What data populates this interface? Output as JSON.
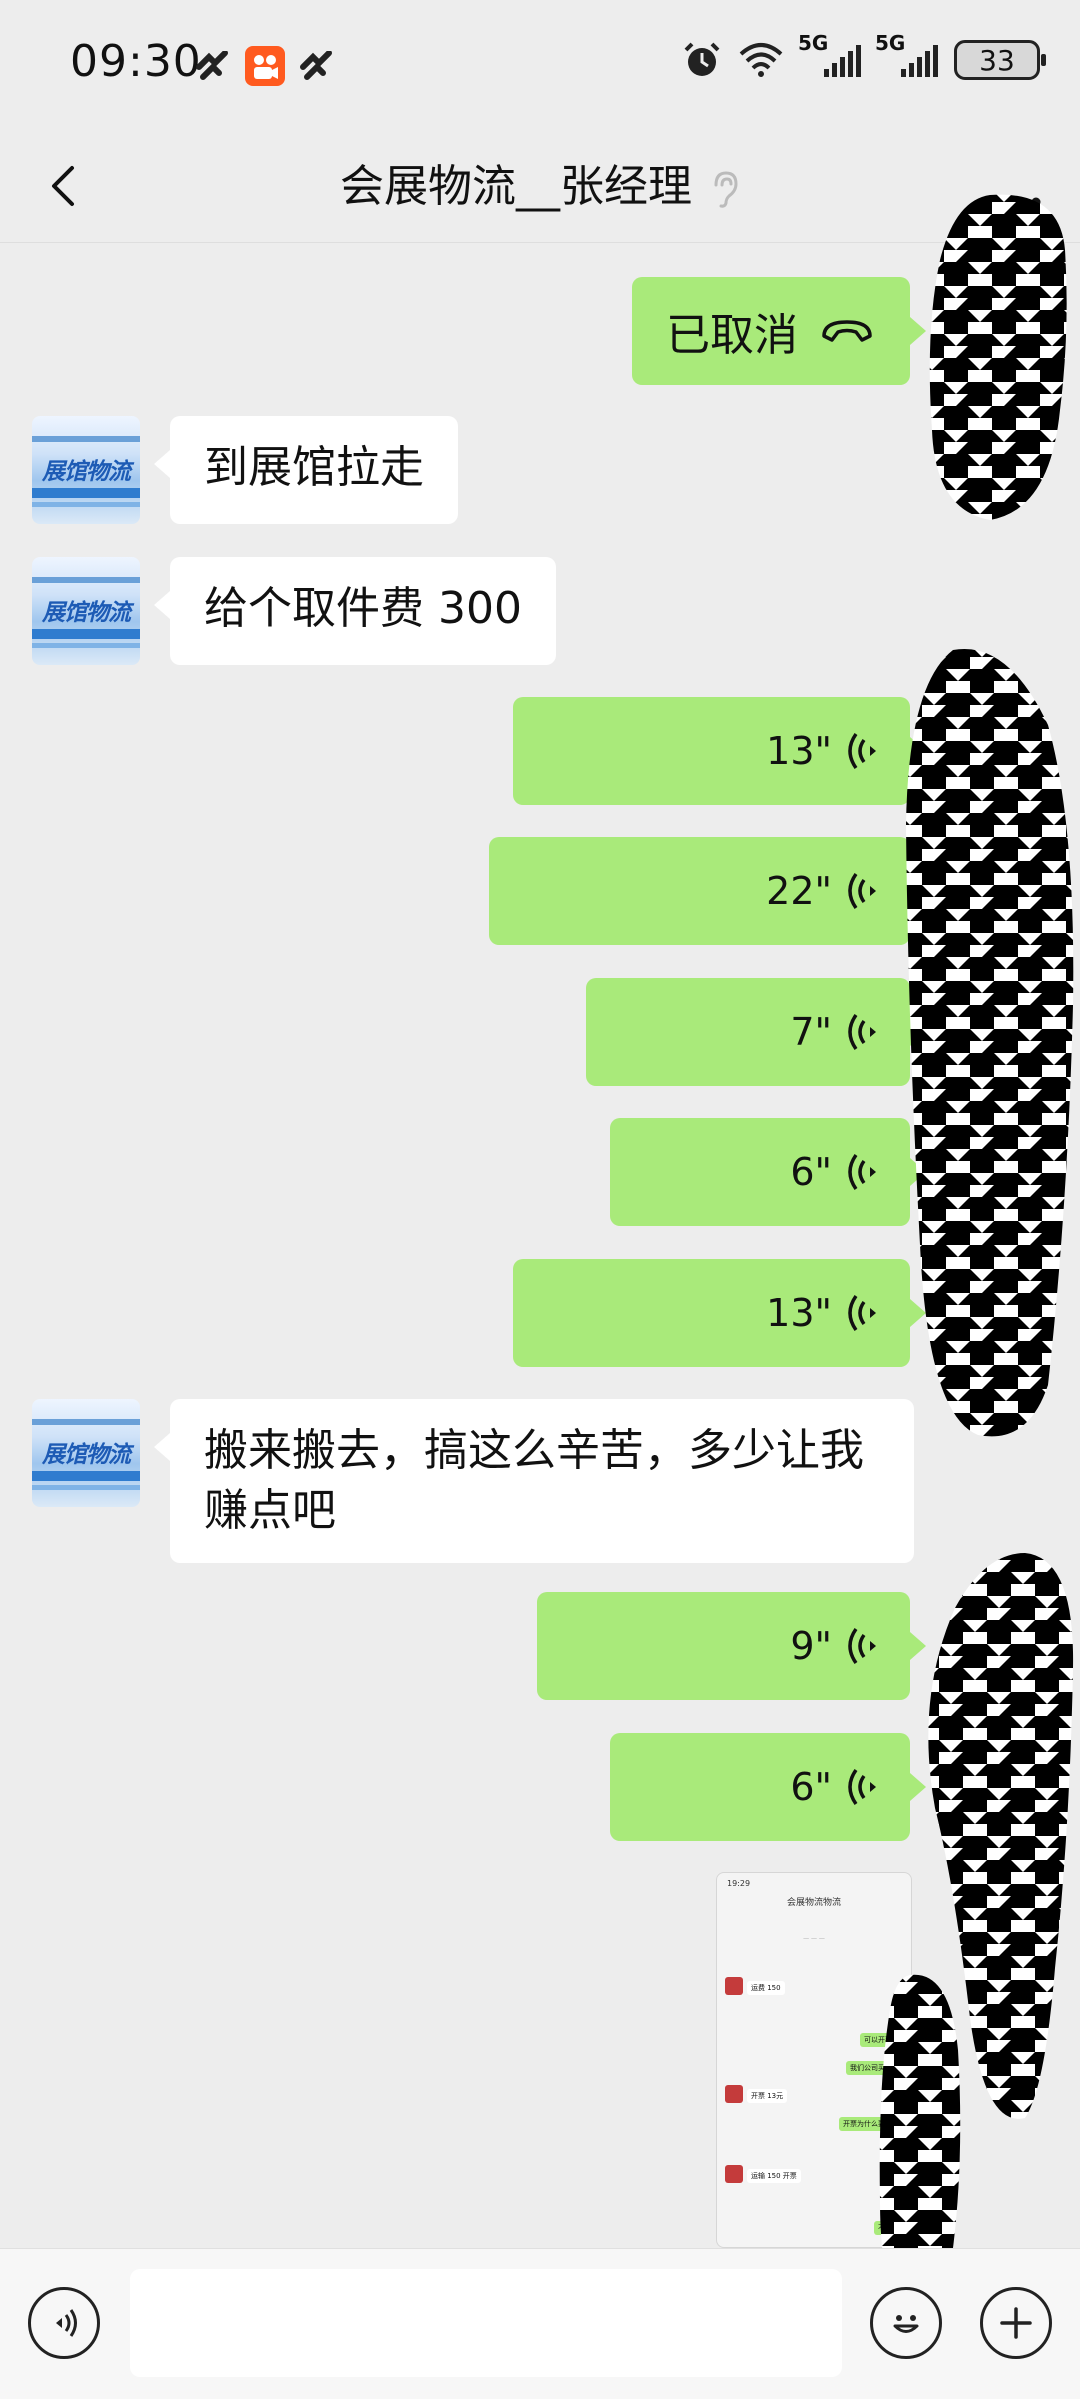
{
  "status_bar": {
    "time": "09:30",
    "network_label_1": "5G",
    "network_label_2": "5G",
    "battery": "33"
  },
  "header": {
    "title": "会展物流__张经理"
  },
  "avatar": {
    "label": "展馆物流"
  },
  "messages": {
    "m1": {
      "text": "已取消"
    },
    "m2": {
      "text": "到展馆拉走"
    },
    "m3": {
      "text": "给个取件费 300"
    },
    "m4": {
      "duration": "13\""
    },
    "m5": {
      "duration": "22\""
    },
    "m6": {
      "duration": "7\""
    },
    "m7": {
      "duration": "6\""
    },
    "m8": {
      "duration": "13\""
    },
    "m9": {
      "text": "搬来搬去，搞这么辛苦，多少让我赚点吧"
    },
    "m10": {
      "duration": "9\""
    },
    "m11": {
      "duration": "6\""
    }
  },
  "thumbnail": {
    "time": "19:29",
    "title": "会展物流物流",
    "rows": [
      "运费 150",
      "可以开票吗",
      "我们公司买运费",
      "开票 13元",
      "开票为什么要加钱",
      "运输 150 开票",
      "不要说"
    ]
  },
  "icons": {
    "back": "chevron-left-icon",
    "ear": "ear-icon",
    "more": "more-dots-icon",
    "voice": "voice-wave-icon",
    "call": "phone-hangup-icon",
    "voice_mode": "voice-mode-icon",
    "emoji": "emoji-icon",
    "plus": "plus-icon"
  },
  "colors": {
    "out_bubble": "#a9ea7a",
    "in_bubble": "#ffffff",
    "background": "#ededed"
  }
}
